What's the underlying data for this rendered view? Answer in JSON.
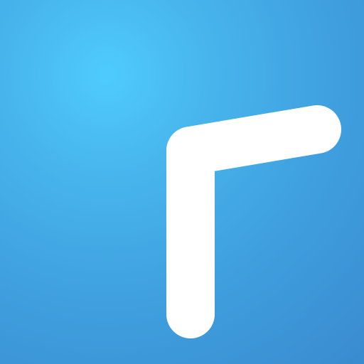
{
  "icon": {
    "name": "clock-hands-icon",
    "background_colors": [
      "#4fcbfd",
      "#3f9fdf",
      "#3a8bd0"
    ],
    "glyph_color": "#ffffff"
  }
}
